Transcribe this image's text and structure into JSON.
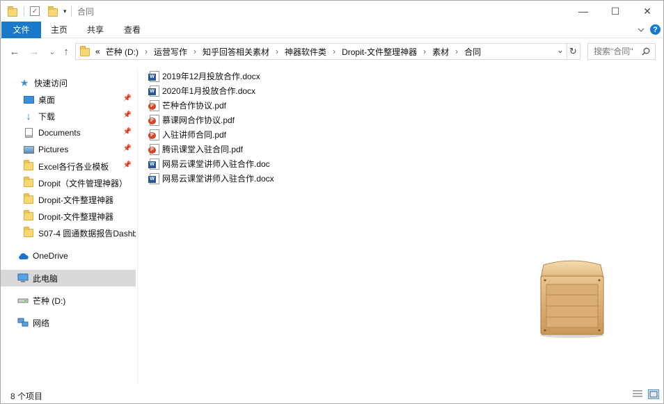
{
  "window": {
    "title": "合同",
    "controls": {
      "minimize": "—",
      "maximize": "☐",
      "close": "✕"
    }
  },
  "ribbon": {
    "tabs": [
      {
        "label": "文件",
        "active": true
      },
      {
        "label": "主页"
      },
      {
        "label": "共享"
      },
      {
        "label": "查看"
      }
    ],
    "expand_icon": "chevron-down-icon",
    "help_icon": "help-icon",
    "help_glyph": "?"
  },
  "navigation": {
    "back_glyph": "←",
    "forward_glyph": "→",
    "recent_glyph": "⌄",
    "up_glyph": "↑",
    "overflow": "«",
    "breadcrumb": [
      "芒种 (D:)",
      "运营写作",
      "知乎回答相关素材",
      "神器软件类",
      "Dropit-文件整理神器",
      "素材",
      "合同"
    ],
    "dropdown_glyph": "⌄",
    "refresh_glyph": "↻",
    "search": {
      "placeholder": "搜索\"合同\"",
      "value": ""
    }
  },
  "sidebar": {
    "quick_access_label": "快速访问",
    "quick_access_items": [
      {
        "label": "桌面",
        "icon": "desktop-icon",
        "pinned": true
      },
      {
        "label": "下载",
        "icon": "download-icon",
        "pinned": true
      },
      {
        "label": "Documents",
        "icon": "documents-icon",
        "pinned": true
      },
      {
        "label": "Pictures",
        "icon": "pictures-icon",
        "pinned": true
      },
      {
        "label": "Excel各行各业模板",
        "icon": "folder-icon",
        "pinned": true
      },
      {
        "label": "Dropit（文件管理神器）",
        "icon": "folder-icon",
        "pinned": false
      },
      {
        "label": "Dropit-文件整理神器",
        "icon": "folder-icon",
        "pinned": false
      },
      {
        "label": "Dropit-文件整理神器",
        "icon": "folder-icon",
        "pinned": false
      },
      {
        "label": "S07-4 圆通数据报告Dashb",
        "icon": "folder-icon",
        "pinned": false
      }
    ],
    "onedrive_label": "OneDrive",
    "this_pc_label": "此电脑",
    "drive_label": "芒种 (D:)",
    "network_label": "网络"
  },
  "files": [
    {
      "name": "2019年12月投放合作.docx",
      "type": "word"
    },
    {
      "name": "2020年1月投放合作.docx",
      "type": "word"
    },
    {
      "name": "芒种合作协议.pdf",
      "type": "pdf"
    },
    {
      "name": "慕课网合作协议.pdf",
      "type": "pdf"
    },
    {
      "name": "入驻讲师合同.pdf",
      "type": "pdf"
    },
    {
      "name": "腾讯课堂入驻合同.pdf",
      "type": "pdf"
    },
    {
      "name": "网易云课堂讲师入驻合作.doc",
      "type": "word"
    },
    {
      "name": "网易云课堂讲师入驻合作.docx",
      "type": "word"
    }
  ],
  "status": {
    "item_count": "8 个项目"
  },
  "colors": {
    "accent": "#1979ca",
    "selection": "#d9d9d9",
    "folder": "#f7d877",
    "word": "#2b5797",
    "pdf": "#d24726"
  }
}
